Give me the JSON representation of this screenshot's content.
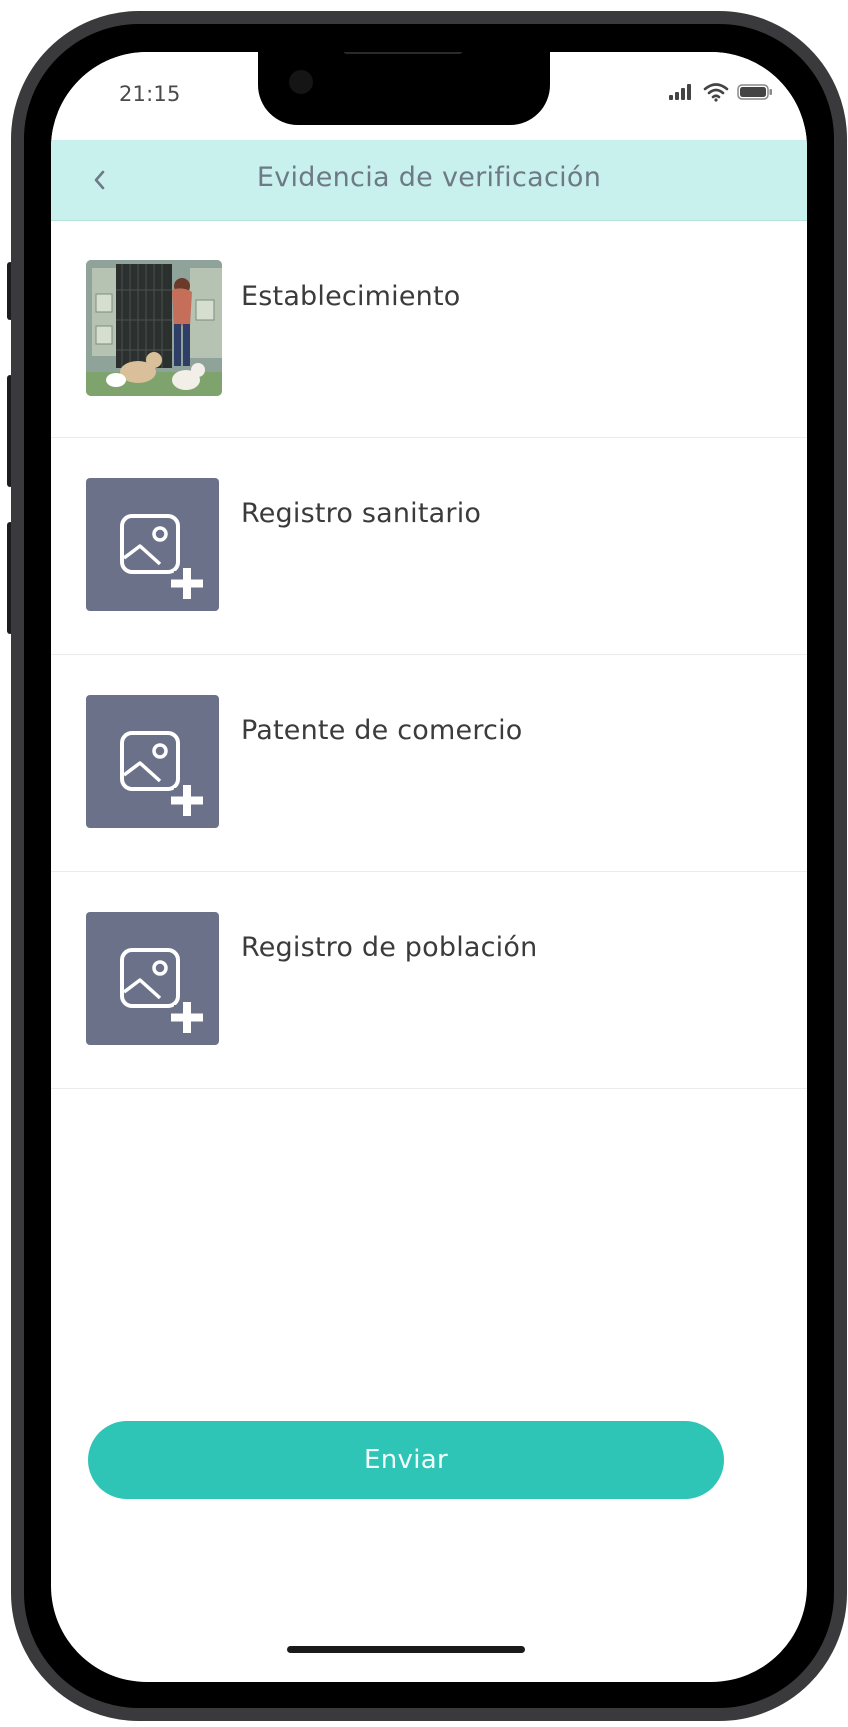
{
  "status_bar": {
    "time": "21:15",
    "icons": [
      "cellular-signal-icon",
      "wifi-icon",
      "battery-icon"
    ]
  },
  "header": {
    "back_icon": "chevron-left-icon",
    "title": "Evidencia de verificación"
  },
  "items": [
    {
      "label": "Establecimiento",
      "has_photo": true
    },
    {
      "label": "Registro sanitario",
      "has_photo": false
    },
    {
      "label": "Patente de comercio",
      "has_photo": false
    },
    {
      "label": "Registro de población",
      "has_photo": false
    }
  ],
  "footer": {
    "send_label": "Enviar"
  },
  "colors": {
    "header_bg": "#c8f0ec",
    "header_text": "#6d7a86",
    "placeholder_bg": "#6b7189",
    "accent": "#2ec4b6",
    "item_text": "#3b3b3b",
    "separator": "#ececec"
  }
}
